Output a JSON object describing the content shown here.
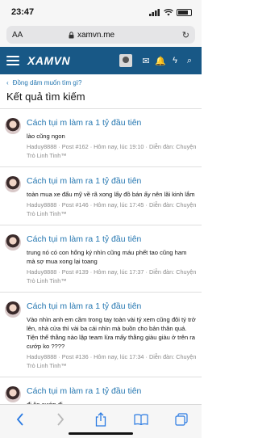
{
  "status": {
    "time": "23:47",
    "location_icon": "location-arrow-icon"
  },
  "browser": {
    "text_size": "AA",
    "url": "xamvn.me",
    "lock_icon": "lock-icon",
    "reload_icon": "reload-icon"
  },
  "nav": {
    "logo": "XAMVN"
  },
  "breadcrumb": "Đồng dâm muốn tìm gì?",
  "page_title": "Kết quả tìm kiếm",
  "results": [
    {
      "title": "Cách tụi m làm ra 1 tỷ đầu tiên",
      "snippet": "lào cũng ngon",
      "meta": "Haduy8888 · Post #162 · Hôm nay, lúc 19:10 · Diễn đàn: Chuyện Trò Linh Tinh™"
    },
    {
      "title": "Cách tụi m làm ra 1 tỷ đầu tiên",
      "snippet": "toàn mua xe đẩu mỹ về rã xong lấy đồ bán ấy nên lãi kinh lắm",
      "meta": "Haduy8888 · Post #146 · Hôm nay, lúc 17:45 · Diễn đàn: Chuyện Trò Linh Tinh™"
    },
    {
      "title": "Cách tụi m làm ra 1 tỷ đầu tiên",
      "snippet": "trung nó có con hổng ký nhìn cũng máu phết tao cũng ham mà sợ mua xong lại toang",
      "meta": "Haduy8888 · Post #139 · Hôm nay, lúc 17:37 · Diễn đàn: Chuyện Trò Linh Tinh™"
    },
    {
      "title": "Cách tụi m làm ra 1 tỷ đầu tiên",
      "snippet": "Vào nhìn anh em cầm trong tay toàn vài tỷ xem cũng đôi tý trở lên, nhà cửa thì vài ba cái nhìn mà buồn cho bản thân quá. Tiện thể thằng nào lập team lừa mấy thằng giàu giàu ở trên ra cướp ko ????",
      "meta": "Haduy8888 · Post #136 · Hôm nay, lúc 17:34 · Diễn đàn: Chuyện Trò Linh Tinh™"
    },
    {
      "title": "Cách tụi m làm ra 1 tỷ đầu tiên",
      "snippet": "đi ăn cướp đi",
      "meta": ""
    }
  ]
}
